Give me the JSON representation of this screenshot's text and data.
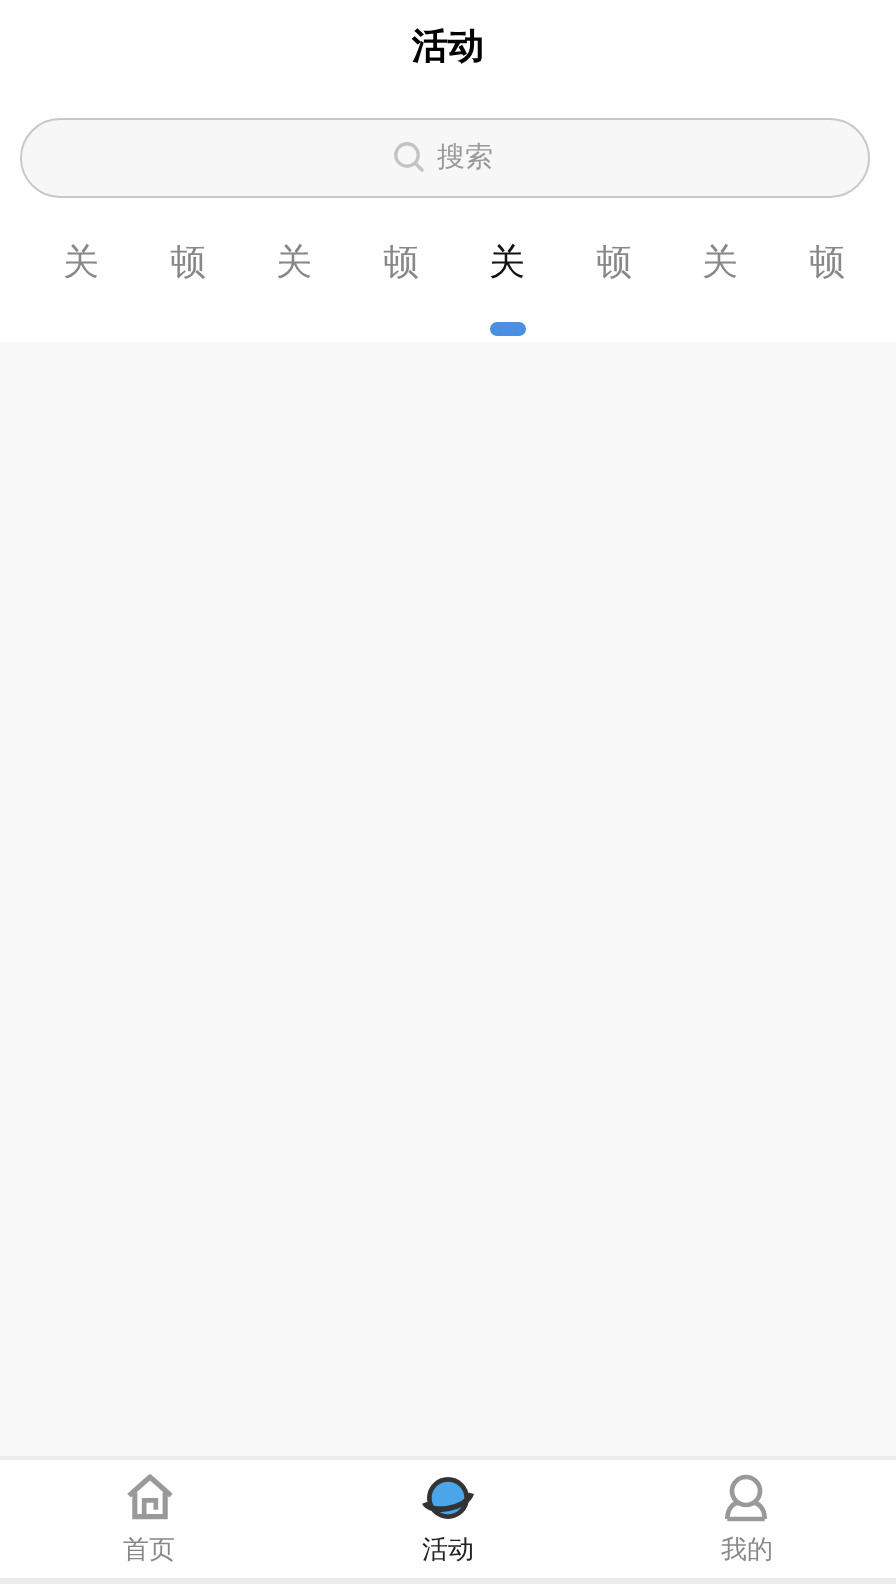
{
  "header": {
    "title": "活动"
  },
  "search": {
    "placeholder": "搜索"
  },
  "tabs": [
    {
      "label": "关",
      "selected": false
    },
    {
      "label": "顿",
      "selected": false
    },
    {
      "label": "关",
      "selected": false
    },
    {
      "label": "顿",
      "selected": false
    },
    {
      "label": "关",
      "selected": true
    },
    {
      "label": "顿",
      "selected": false
    },
    {
      "label": "关",
      "selected": false
    },
    {
      "label": "顿",
      "selected": false
    }
  ],
  "bottom_nav": [
    {
      "label": "首页",
      "selected": false
    },
    {
      "label": "活动",
      "selected": true
    },
    {
      "label": "我的",
      "selected": false
    }
  ]
}
